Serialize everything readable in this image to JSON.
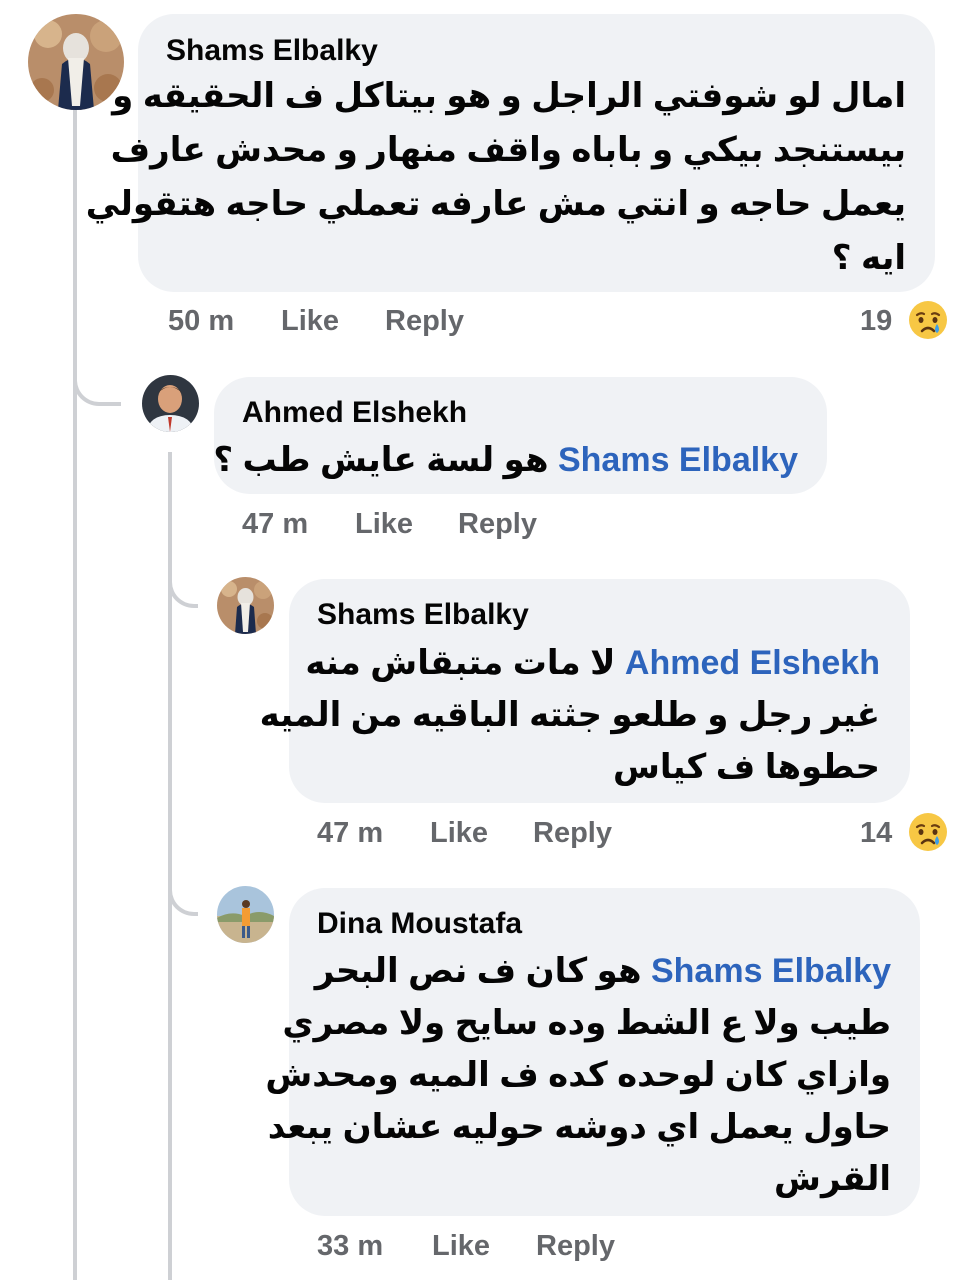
{
  "comments": [
    {
      "author": "Shams Elbalky",
      "lines": [
        "امال لو شوفتي الراجل و هو بيتاكل ف الحقيقه و",
        "بيستنجد بيكي و باباه واقف منهار و محدش عارف",
        "يعمل حاجه و انتي مش عارفه تعملي حاجه هتقولي",
        "ايه ؟"
      ],
      "time": "50 m",
      "like": "Like",
      "reply": "Reply",
      "reaction_count": "19",
      "reaction_icon": "crying-face-icon"
    },
    {
      "author": "Ahmed Elshekh",
      "mention": "Shams Elbalky",
      "lines": [
        "هو لسة عايش طب ؟"
      ],
      "time": "47 m",
      "like": "Like",
      "reply": "Reply"
    },
    {
      "author": "Shams Elbalky",
      "mention": "Ahmed Elshekh",
      "lines": [
        "لا مات متبقاش منه",
        "غير رجل و طلعو جثته الباقيه من الميه",
        "حطوها ف كياس"
      ],
      "time": "47 m",
      "like": "Like",
      "reply": "Reply",
      "reaction_count": "14",
      "reaction_icon": "crying-face-icon"
    },
    {
      "author": "Dina Moustafa",
      "mention": "Shams Elbalky",
      "lines": [
        "هو كان ف نص البحر",
        "طيب ولا ع الشط وده سايح ولا مصري",
        "وازاي كان لوحده كده ف الميه ومحدش",
        "حاول يعمل اي دوشه حوليه عشان يبعد",
        "القرش"
      ],
      "time": "33 m",
      "like": "Like",
      "reply": "Reply"
    }
  ],
  "colors": {
    "bubble": "#f0f2f5",
    "mention": "#2d64bc",
    "meta": "#65676b",
    "thread_line": "#ced0d4"
  }
}
